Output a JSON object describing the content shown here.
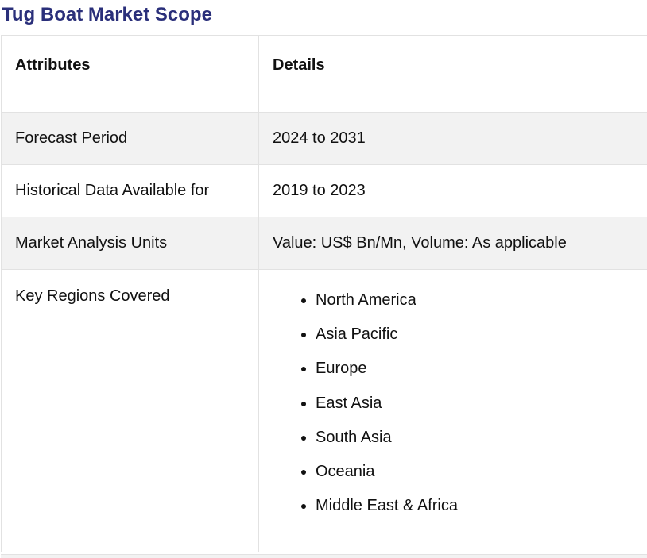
{
  "title": "Tug Boat Market Scope",
  "table": {
    "headers": {
      "attributes": "Attributes",
      "details": "Details"
    },
    "rows": [
      {
        "attribute": "Forecast Period",
        "detail": "2024 to 2031"
      },
      {
        "attribute": "Historical Data Available for",
        "detail": "2019 to 2023"
      },
      {
        "attribute": "Market Analysis Units",
        "detail": "Value: US$ Bn/Mn, Volume: As applicable"
      }
    ],
    "regions": {
      "attribute": "Key Regions Covered",
      "items": [
        "North America",
        "Asia Pacific",
        "Europe",
        "East Asia",
        "South Asia",
        "Oceania",
        "Middle East & Africa"
      ]
    }
  },
  "colors": {
    "title": "#2a2f7a",
    "shaded_row": "#f2f2f2",
    "border": "#e2e2e2"
  }
}
